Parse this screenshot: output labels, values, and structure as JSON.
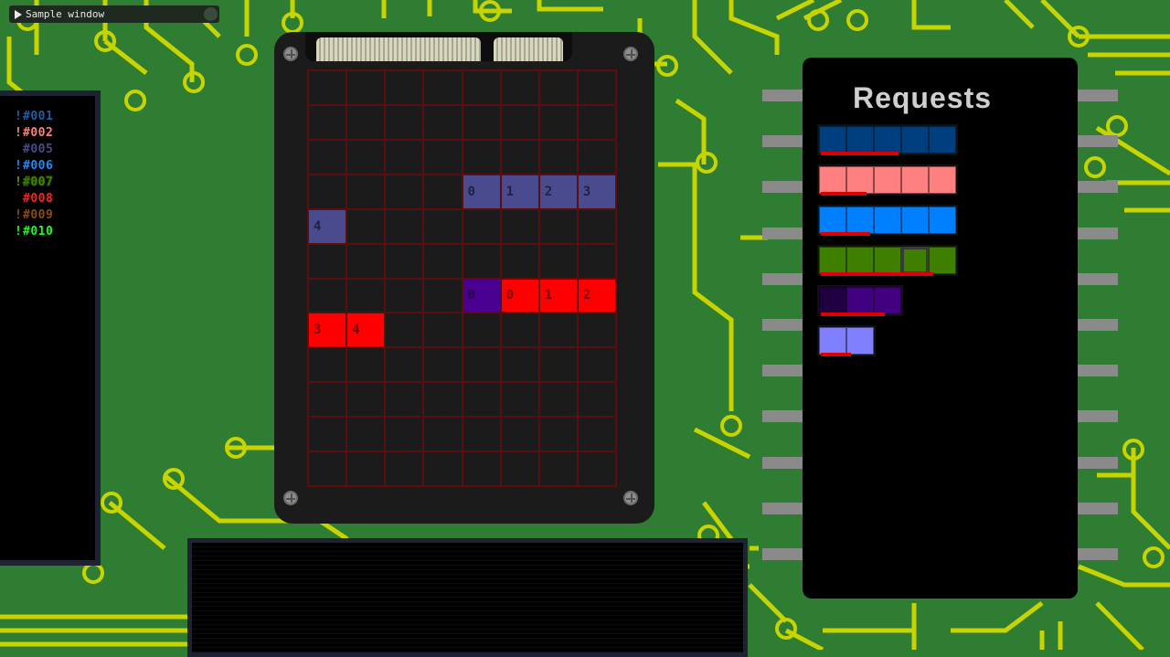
{
  "window": {
    "title": "Sample window"
  },
  "processes": [
    {
      "bang": "!",
      "id": "#001",
      "color": "#1f5fa8"
    },
    {
      "bang": "!",
      "id": "#002",
      "color": "#ff8080"
    },
    {
      "bang": "",
      "id": "#005",
      "color": "#4a4a8f"
    },
    {
      "bang": "!",
      "id": "#006",
      "color": "#1a8cff"
    },
    {
      "bang": "!",
      "id": "#007",
      "color": "#4a8f00",
      "highlight": true
    },
    {
      "bang": "",
      "id": "#008",
      "color": "#ff2020"
    },
    {
      "bang": "!",
      "id": "#009",
      "color": "#8f4a10"
    },
    {
      "bang": "!",
      "id": "#010",
      "color": "#1aff1a"
    }
  ],
  "memory": {
    "cells": [
      {
        "row": 3,
        "col": 4,
        "label": "0",
        "color": "#4a4a8f"
      },
      {
        "row": 3,
        "col": 5,
        "label": "1",
        "color": "#4a4a8f"
      },
      {
        "row": 3,
        "col": 6,
        "label": "2",
        "color": "#4a4a8f"
      },
      {
        "row": 3,
        "col": 7,
        "label": "3",
        "color": "#4a4a8f"
      },
      {
        "row": 4,
        "col": 0,
        "label": "4",
        "color": "#4a4a8f"
      },
      {
        "row": 6,
        "col": 4,
        "label": "0",
        "color": "#4a0090"
      },
      {
        "row": 6,
        "col": 5,
        "label": "0",
        "color": "#ff0000"
      },
      {
        "row": 6,
        "col": 6,
        "label": "1",
        "color": "#ff0000"
      },
      {
        "row": 6,
        "col": 7,
        "label": "2",
        "color": "#ff0000"
      },
      {
        "row": 7,
        "col": 0,
        "label": "3",
        "color": "#ff0000"
      },
      {
        "row": 7,
        "col": 1,
        "label": "4",
        "color": "#ff0000"
      }
    ]
  },
  "requests": {
    "title": "Requests",
    "items": [
      {
        "count": 5,
        "color": "#003f7f",
        "progress": 0.57
      },
      {
        "count": 5,
        "color": "#ff8080",
        "progress": 0.33
      },
      {
        "count": 5,
        "color": "#0080ff",
        "progress": 0.36
      },
      {
        "count": 5,
        "color": "#3f7f00",
        "progress": 0.82,
        "selected": 3
      },
      {
        "count": 3,
        "color": "#400080",
        "progress": 0.78,
        "first_dark": "#200040"
      },
      {
        "count": 2,
        "color": "#8080ff",
        "progress": 0.55
      }
    ]
  }
}
